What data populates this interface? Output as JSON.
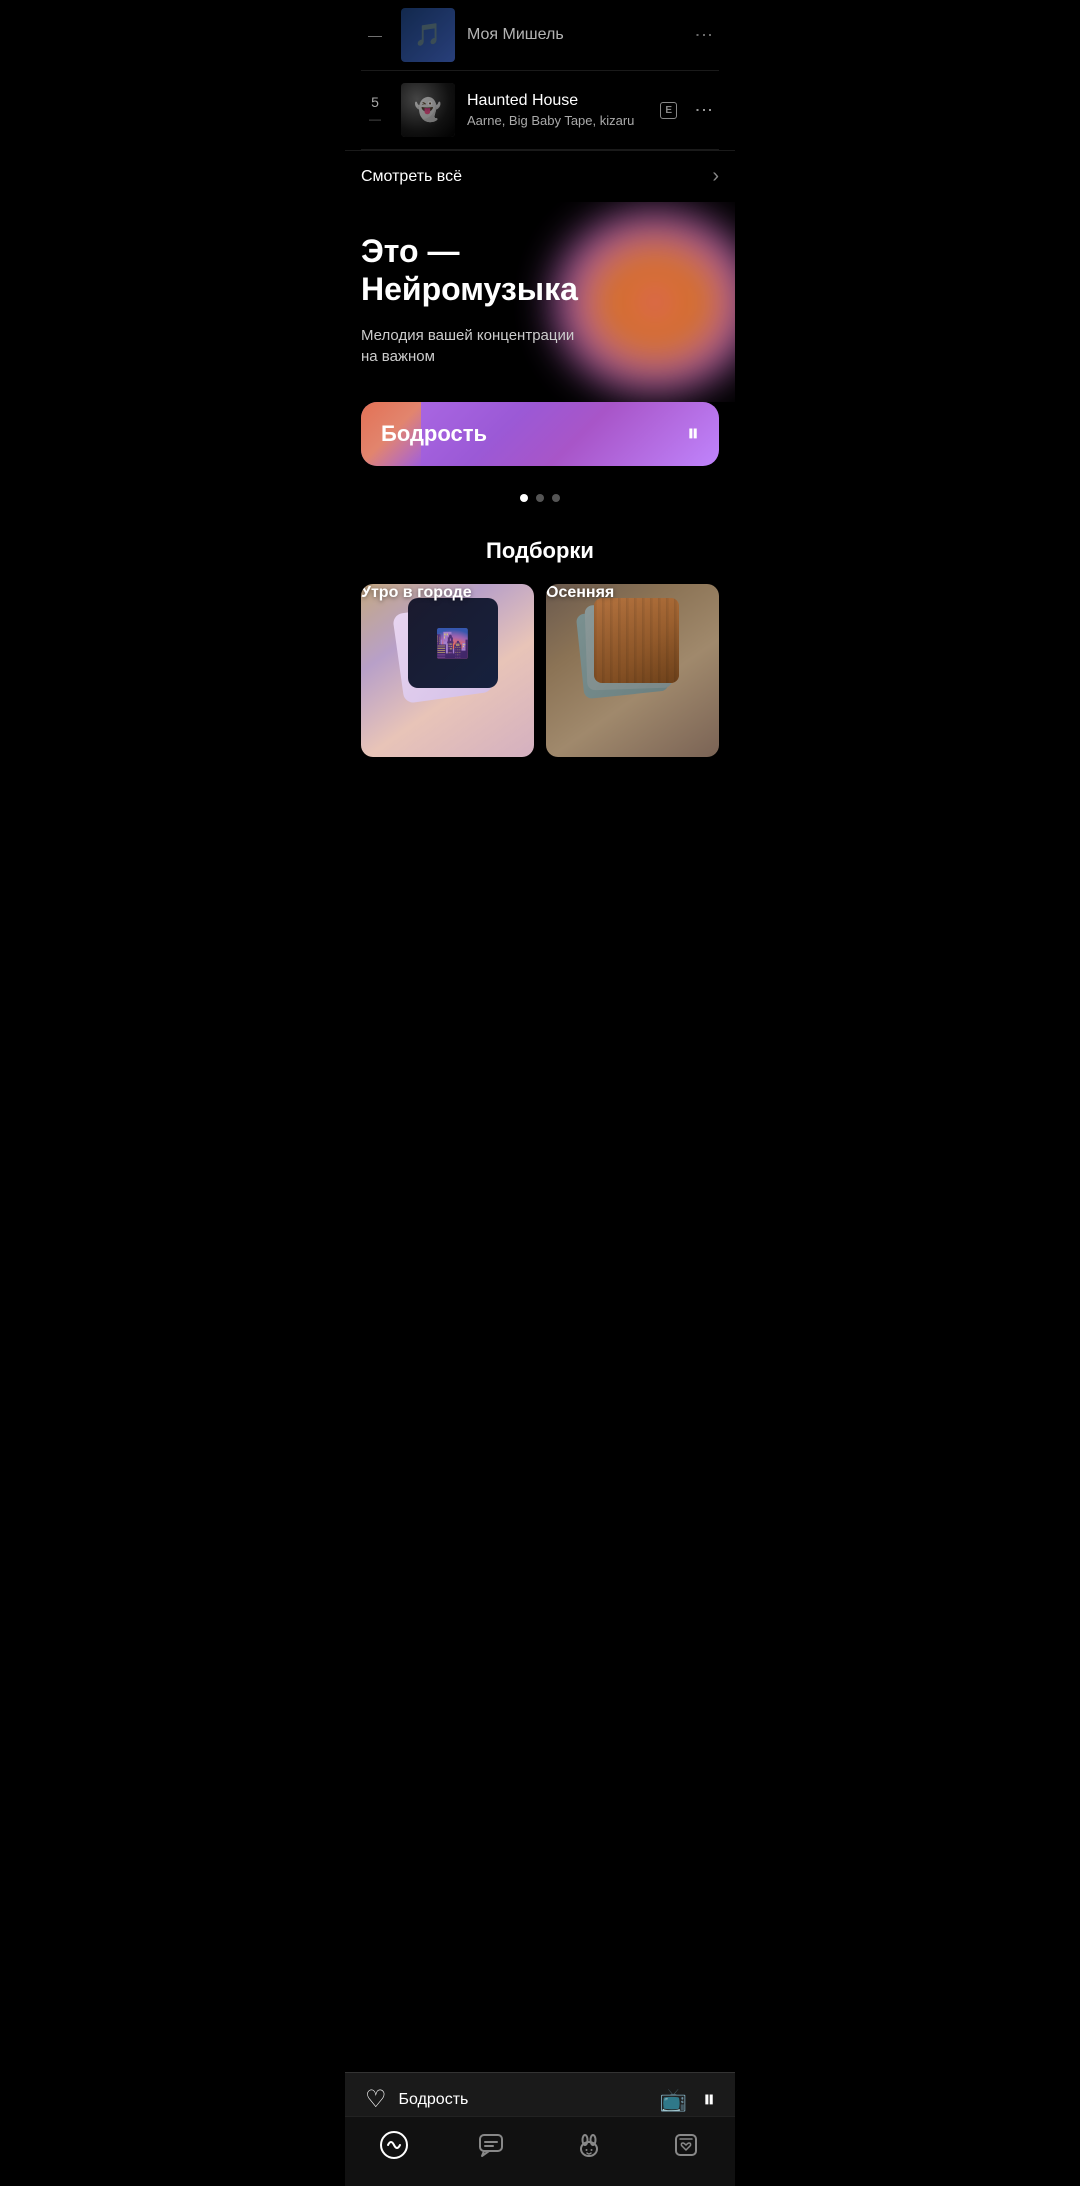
{
  "previous_track": {
    "title": "Моя Мишель",
    "artists": "",
    "thumb_emoji": "🎵"
  },
  "track5": {
    "number": "5",
    "dash": "—",
    "title": "Haunted House",
    "artists": "Aarne, Big Baby Tape, kizaru",
    "explicit": "E"
  },
  "see_all": {
    "label": "Смотреть всё",
    "arrow": "›"
  },
  "neiromusika": {
    "title": "Это —\nНейромузыка",
    "subtitle": "Мелодия вашей концентрации\nна важном",
    "card_label": "Бодрость"
  },
  "dots": {
    "active": 0,
    "total": 3
  },
  "collections": {
    "section_title": "Подборки",
    "items": [
      {
        "name": "Утро в городе",
        "id": "utro"
      },
      {
        "name": "Осенняя",
        "id": "osen"
      }
    ]
  },
  "now_playing": {
    "title": "Бодрость"
  },
  "bottom_nav": {
    "items": [
      {
        "icon": "🎵",
        "label": "home",
        "active": true
      },
      {
        "icon": "💬",
        "label": "chat",
        "active": false
      },
      {
        "icon": "🐰",
        "label": "avatar",
        "active": false
      },
      {
        "icon": "📋",
        "label": "library",
        "active": false
      }
    ]
  }
}
